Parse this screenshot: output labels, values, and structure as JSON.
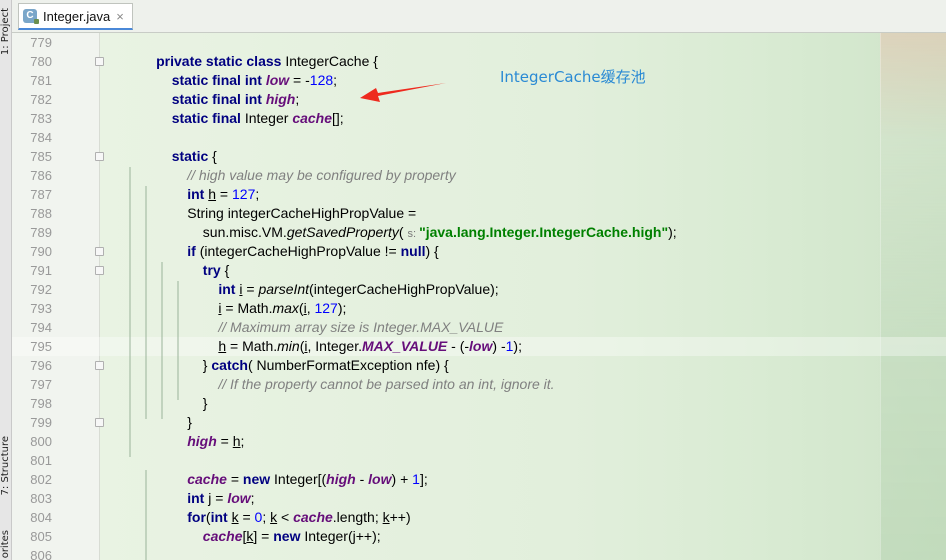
{
  "side_panel": {
    "project_tab": "1: Project",
    "structure_tab": "7: Structure",
    "favorites_tab": "orites"
  },
  "tab": {
    "label": "Integer.java",
    "close_icon": "×",
    "icon_letter": "C"
  },
  "annotation": {
    "text": "IntegerCache缓存池",
    "color": "#2a8ad4",
    "arrow_color": "#ee2a1e"
  },
  "colors": {
    "keyword": "#000080",
    "string": "#008000",
    "number": "#0000ff",
    "comment": "#808080",
    "field": "#660e7a"
  },
  "lines": [
    {
      "n": "779",
      "fold": false,
      "segs": []
    },
    {
      "n": "780",
      "fold": true,
      "segs": [
        [
          "        ",
          ""
        ],
        [
          "private static class ",
          "k"
        ],
        [
          "IntegerCache {",
          ""
        ]
      ]
    },
    {
      "n": "781",
      "fold": false,
      "segs": [
        [
          "            ",
          ""
        ],
        [
          "static final int ",
          "k"
        ],
        [
          "low",
          "f"
        ],
        [
          " = -",
          ""
        ],
        [
          "128",
          "n"
        ],
        [
          ";",
          ""
        ]
      ]
    },
    {
      "n": "782",
      "fold": false,
      "segs": [
        [
          "            ",
          ""
        ],
        [
          "static final int ",
          "k"
        ],
        [
          "high",
          "f"
        ],
        [
          ";",
          ""
        ]
      ]
    },
    {
      "n": "783",
      "fold": false,
      "segs": [
        [
          "            ",
          ""
        ],
        [
          "static final ",
          "k"
        ],
        [
          "Integer ",
          ""
        ],
        [
          "cache",
          "f"
        ],
        [
          "[];",
          ""
        ]
      ]
    },
    {
      "n": "784",
      "fold": false,
      "segs": []
    },
    {
      "n": "785",
      "fold": true,
      "segs": [
        [
          "            ",
          ""
        ],
        [
          "static ",
          "k"
        ],
        [
          "{",
          ""
        ]
      ]
    },
    {
      "n": "786",
      "fold": false,
      "segs": [
        [
          "                ",
          ""
        ],
        [
          "// high value may be configured by property",
          "c"
        ]
      ]
    },
    {
      "n": "787",
      "fold": false,
      "segs": [
        [
          "                ",
          ""
        ],
        [
          "int ",
          "k"
        ],
        [
          "h",
          "u"
        ],
        [
          " = ",
          ""
        ],
        [
          "127",
          "n"
        ],
        [
          ";",
          ""
        ]
      ]
    },
    {
      "n": "788",
      "fold": false,
      "segs": [
        [
          "                ",
          ""
        ],
        [
          "String integerCacheHighPropValue =",
          ""
        ]
      ]
    },
    {
      "n": "789",
      "fold": false,
      "segs": [
        [
          "                    ",
          ""
        ],
        [
          "sun.misc.VM.",
          ""
        ],
        [
          "getSavedProperty",
          "m"
        ],
        [
          "( ",
          ""
        ],
        [
          "s: ",
          "p"
        ],
        [
          "\"java.lang.Integer.IntegerCache.high\"",
          "s"
        ],
        [
          ");",
          ""
        ]
      ]
    },
    {
      "n": "790",
      "fold": true,
      "segs": [
        [
          "                ",
          ""
        ],
        [
          "if ",
          "k"
        ],
        [
          "(integerCacheHighPropValue != ",
          ""
        ],
        [
          "null",
          "k"
        ],
        [
          ") {",
          ""
        ]
      ]
    },
    {
      "n": "791",
      "fold": true,
      "segs": [
        [
          "                    ",
          ""
        ],
        [
          "try ",
          "k"
        ],
        [
          "{",
          ""
        ]
      ]
    },
    {
      "n": "792",
      "fold": false,
      "segs": [
        [
          "                        ",
          ""
        ],
        [
          "int ",
          "k"
        ],
        [
          "i",
          "u"
        ],
        [
          " = ",
          ""
        ],
        [
          "parseInt",
          "m"
        ],
        [
          "(integerCacheHighPropValue);",
          ""
        ]
      ]
    },
    {
      "n": "793",
      "fold": false,
      "segs": [
        [
          "                        ",
          ""
        ],
        [
          "i",
          "u"
        ],
        [
          " = Math.",
          ""
        ],
        [
          "max",
          "m"
        ],
        [
          "(",
          ""
        ],
        [
          "i",
          "u"
        ],
        [
          ", ",
          ""
        ],
        [
          "127",
          "n"
        ],
        [
          ");",
          ""
        ]
      ]
    },
    {
      "n": "794",
      "fold": false,
      "segs": [
        [
          "                        ",
          ""
        ],
        [
          "// Maximum array size is Integer.MAX_VALUE",
          "c"
        ]
      ]
    },
    {
      "n": "795",
      "fold": false,
      "segs": [
        [
          "                        ",
          ""
        ],
        [
          "h",
          "u"
        ],
        [
          " = Math.",
          ""
        ],
        [
          "min",
          "m"
        ],
        [
          "(",
          ""
        ],
        [
          "i",
          "u"
        ],
        [
          ", Integer.",
          ""
        ],
        [
          "MAX_VALUE",
          "f"
        ],
        [
          " - (-",
          ""
        ],
        [
          "low",
          "f"
        ],
        [
          ") -",
          ""
        ],
        [
          "1",
          "n"
        ],
        [
          ");",
          ""
        ]
      ]
    },
    {
      "n": "796",
      "fold": true,
      "segs": [
        [
          "                    ",
          ""
        ],
        [
          "} ",
          ""
        ],
        [
          "catch",
          "k"
        ],
        [
          "( NumberFormatException nfe) {",
          ""
        ]
      ]
    },
    {
      "n": "797",
      "fold": false,
      "segs": [
        [
          "                        ",
          ""
        ],
        [
          "// If the property cannot be parsed into an int, ignore it.",
          "c"
        ]
      ]
    },
    {
      "n": "798",
      "fold": false,
      "segs": [
        [
          "                    ",
          ""
        ],
        [
          "}",
          ""
        ]
      ]
    },
    {
      "n": "799",
      "fold": true,
      "segs": [
        [
          "                ",
          ""
        ],
        [
          "}",
          ""
        ]
      ]
    },
    {
      "n": "800",
      "fold": false,
      "segs": [
        [
          "                ",
          ""
        ],
        [
          "high",
          "f"
        ],
        [
          " = ",
          ""
        ],
        [
          "h",
          "u"
        ],
        [
          ";",
          ""
        ]
      ]
    },
    {
      "n": "801",
      "fold": false,
      "segs": []
    },
    {
      "n": "802",
      "fold": false,
      "segs": [
        [
          "                ",
          ""
        ],
        [
          "cache",
          "f"
        ],
        [
          " = ",
          ""
        ],
        [
          "new ",
          "k"
        ],
        [
          "Integer[(",
          ""
        ],
        [
          "high",
          "f"
        ],
        [
          " - ",
          ""
        ],
        [
          "low",
          "f"
        ],
        [
          ") + ",
          ""
        ],
        [
          "1",
          "n"
        ],
        [
          "];",
          ""
        ]
      ]
    },
    {
      "n": "803",
      "fold": false,
      "segs": [
        [
          "                ",
          ""
        ],
        [
          "int ",
          "k"
        ],
        [
          "j",
          "u"
        ],
        [
          " = ",
          ""
        ],
        [
          "low",
          "f"
        ],
        [
          ";",
          ""
        ]
      ]
    },
    {
      "n": "804",
      "fold": false,
      "segs": [
        [
          "                ",
          ""
        ],
        [
          "for",
          "k"
        ],
        [
          "(",
          ""
        ],
        [
          "int ",
          "k"
        ],
        [
          "k",
          "u"
        ],
        [
          " = ",
          ""
        ],
        [
          "0",
          "n"
        ],
        [
          "; ",
          ""
        ],
        [
          "k",
          "u"
        ],
        [
          " < ",
          ""
        ],
        [
          "cache",
          "f"
        ],
        [
          ".length; ",
          ""
        ],
        [
          "k",
          "u"
        ],
        [
          "++)",
          ""
        ]
      ]
    },
    {
      "n": "805",
      "fold": false,
      "segs": [
        [
          "                    ",
          ""
        ],
        [
          "cache",
          "f"
        ],
        [
          "[",
          ""
        ],
        [
          "k",
          "u"
        ],
        [
          "] = ",
          ""
        ],
        [
          "new ",
          "k"
        ],
        [
          "Integer(j++);",
          ""
        ]
      ]
    },
    {
      "n": "806",
      "fold": false,
      "segs": []
    }
  ]
}
